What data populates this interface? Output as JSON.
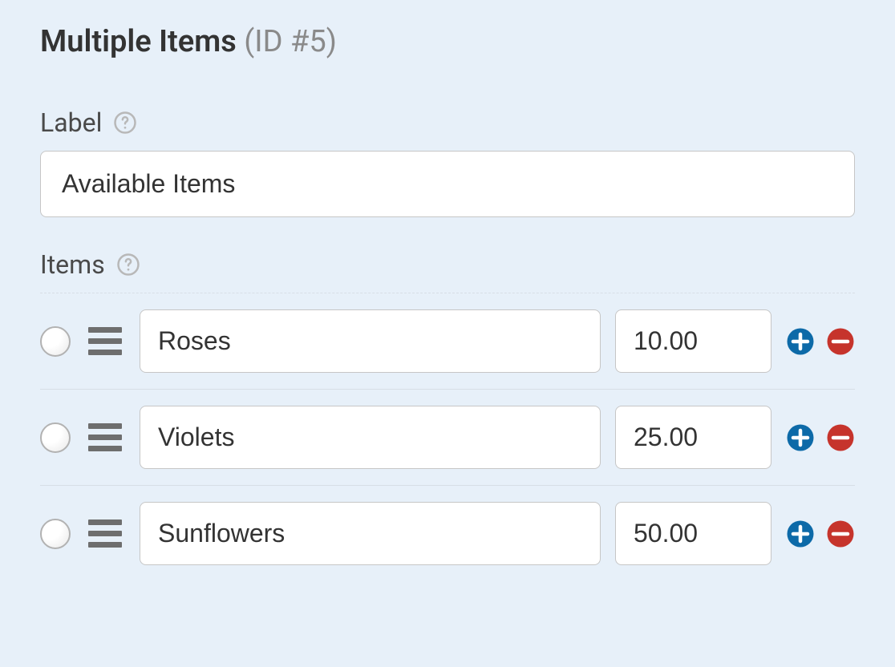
{
  "header": {
    "title": "Multiple Items",
    "id_label": "(ID #5)"
  },
  "label_section": {
    "label": "Label",
    "value": "Available Items"
  },
  "items_section": {
    "label": "Items",
    "rows": [
      {
        "name": "Roses",
        "price": "10.00"
      },
      {
        "name": "Violets",
        "price": "25.00"
      },
      {
        "name": "Sunflowers",
        "price": "50.00"
      }
    ]
  }
}
